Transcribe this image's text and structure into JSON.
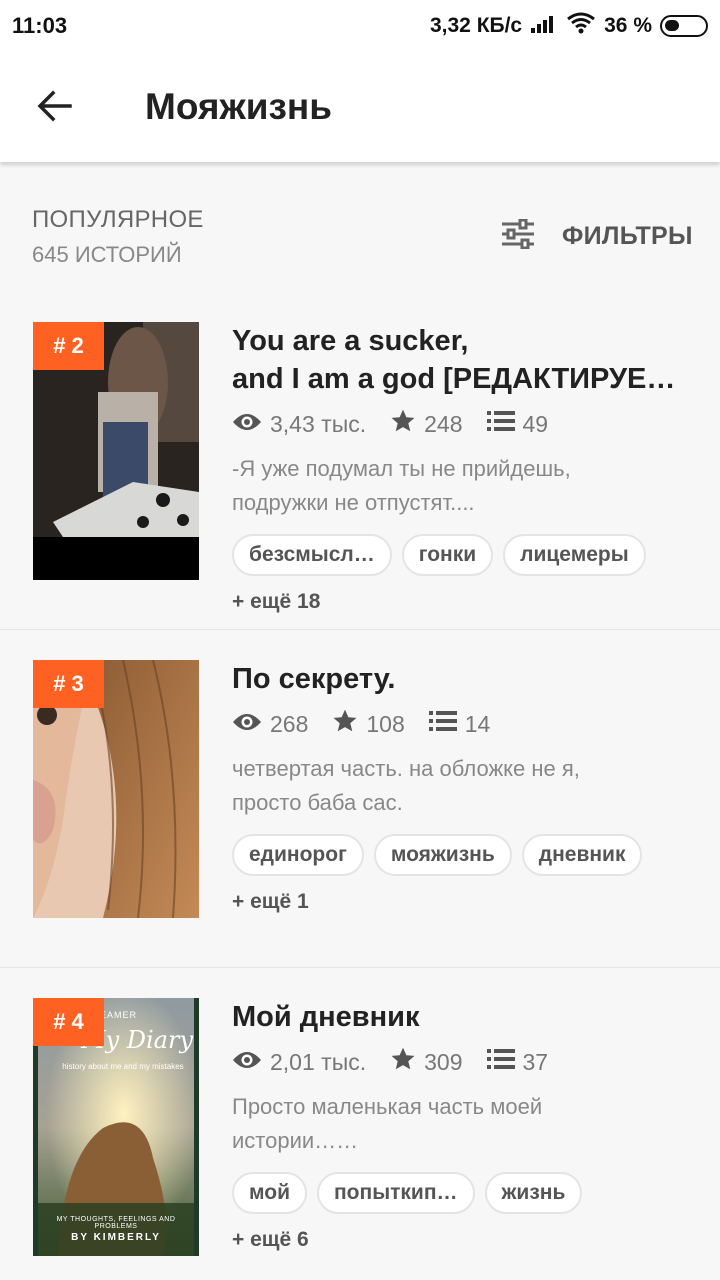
{
  "status": {
    "time": "11:03",
    "speed": "3,32 КБ/с",
    "battery": "36 %"
  },
  "appbar": {
    "title": "Мояжизнь"
  },
  "header": {
    "sort_label": "ПОПУЛЯРНОЕ",
    "count": "645 ИСТОРИЙ",
    "filters_label": "ФИЛЬТРЫ"
  },
  "stories": [
    {
      "rank": "# 2",
      "title_line1": "You are a sucker,",
      "title_line2": "and I am a god [РЕДАКТИРУЕ…",
      "views": "3,43 тыс.",
      "votes": "248",
      "parts": "49",
      "desc_line1": "-Я уже подумал ты не прийдешь,",
      "desc_line2": "подружки не отпустят....",
      "tags": [
        "безсмысл…",
        "гонки",
        "лицемеры"
      ],
      "more": "+ ещё 18"
    },
    {
      "rank": "# 3",
      "title_line1": "По секрету.",
      "views": "268",
      "votes": "108",
      "parts": "14",
      "desc_line1": "четвертая часть. на обложке не я,",
      "desc_line2": "просто баба сас.",
      "tags": [
        "единорог",
        "мояжизнь",
        "дневник"
      ],
      "more": "+ ещё 1"
    },
    {
      "rank": "# 4",
      "title_line1": "Мой дневник",
      "views": "2,01 тыс.",
      "votes": "309",
      "parts": "37",
      "desc_line1": "Просто маленькая часть моей",
      "desc_line2": "истории……",
      "tags": [
        "мой",
        "попыткип…",
        "жизнь"
      ],
      "more": "+ ещё 6",
      "cover_text": {
        "top": "DREAMER",
        "title": "My Diary",
        "sub": "history about me and my mistakes",
        "caption": "MY THOUGHTS, FEELINGS AND PROBLEMS",
        "author": "BY KIMBERLY"
      }
    }
  ],
  "colors": {
    "accent": "#ff6122"
  }
}
